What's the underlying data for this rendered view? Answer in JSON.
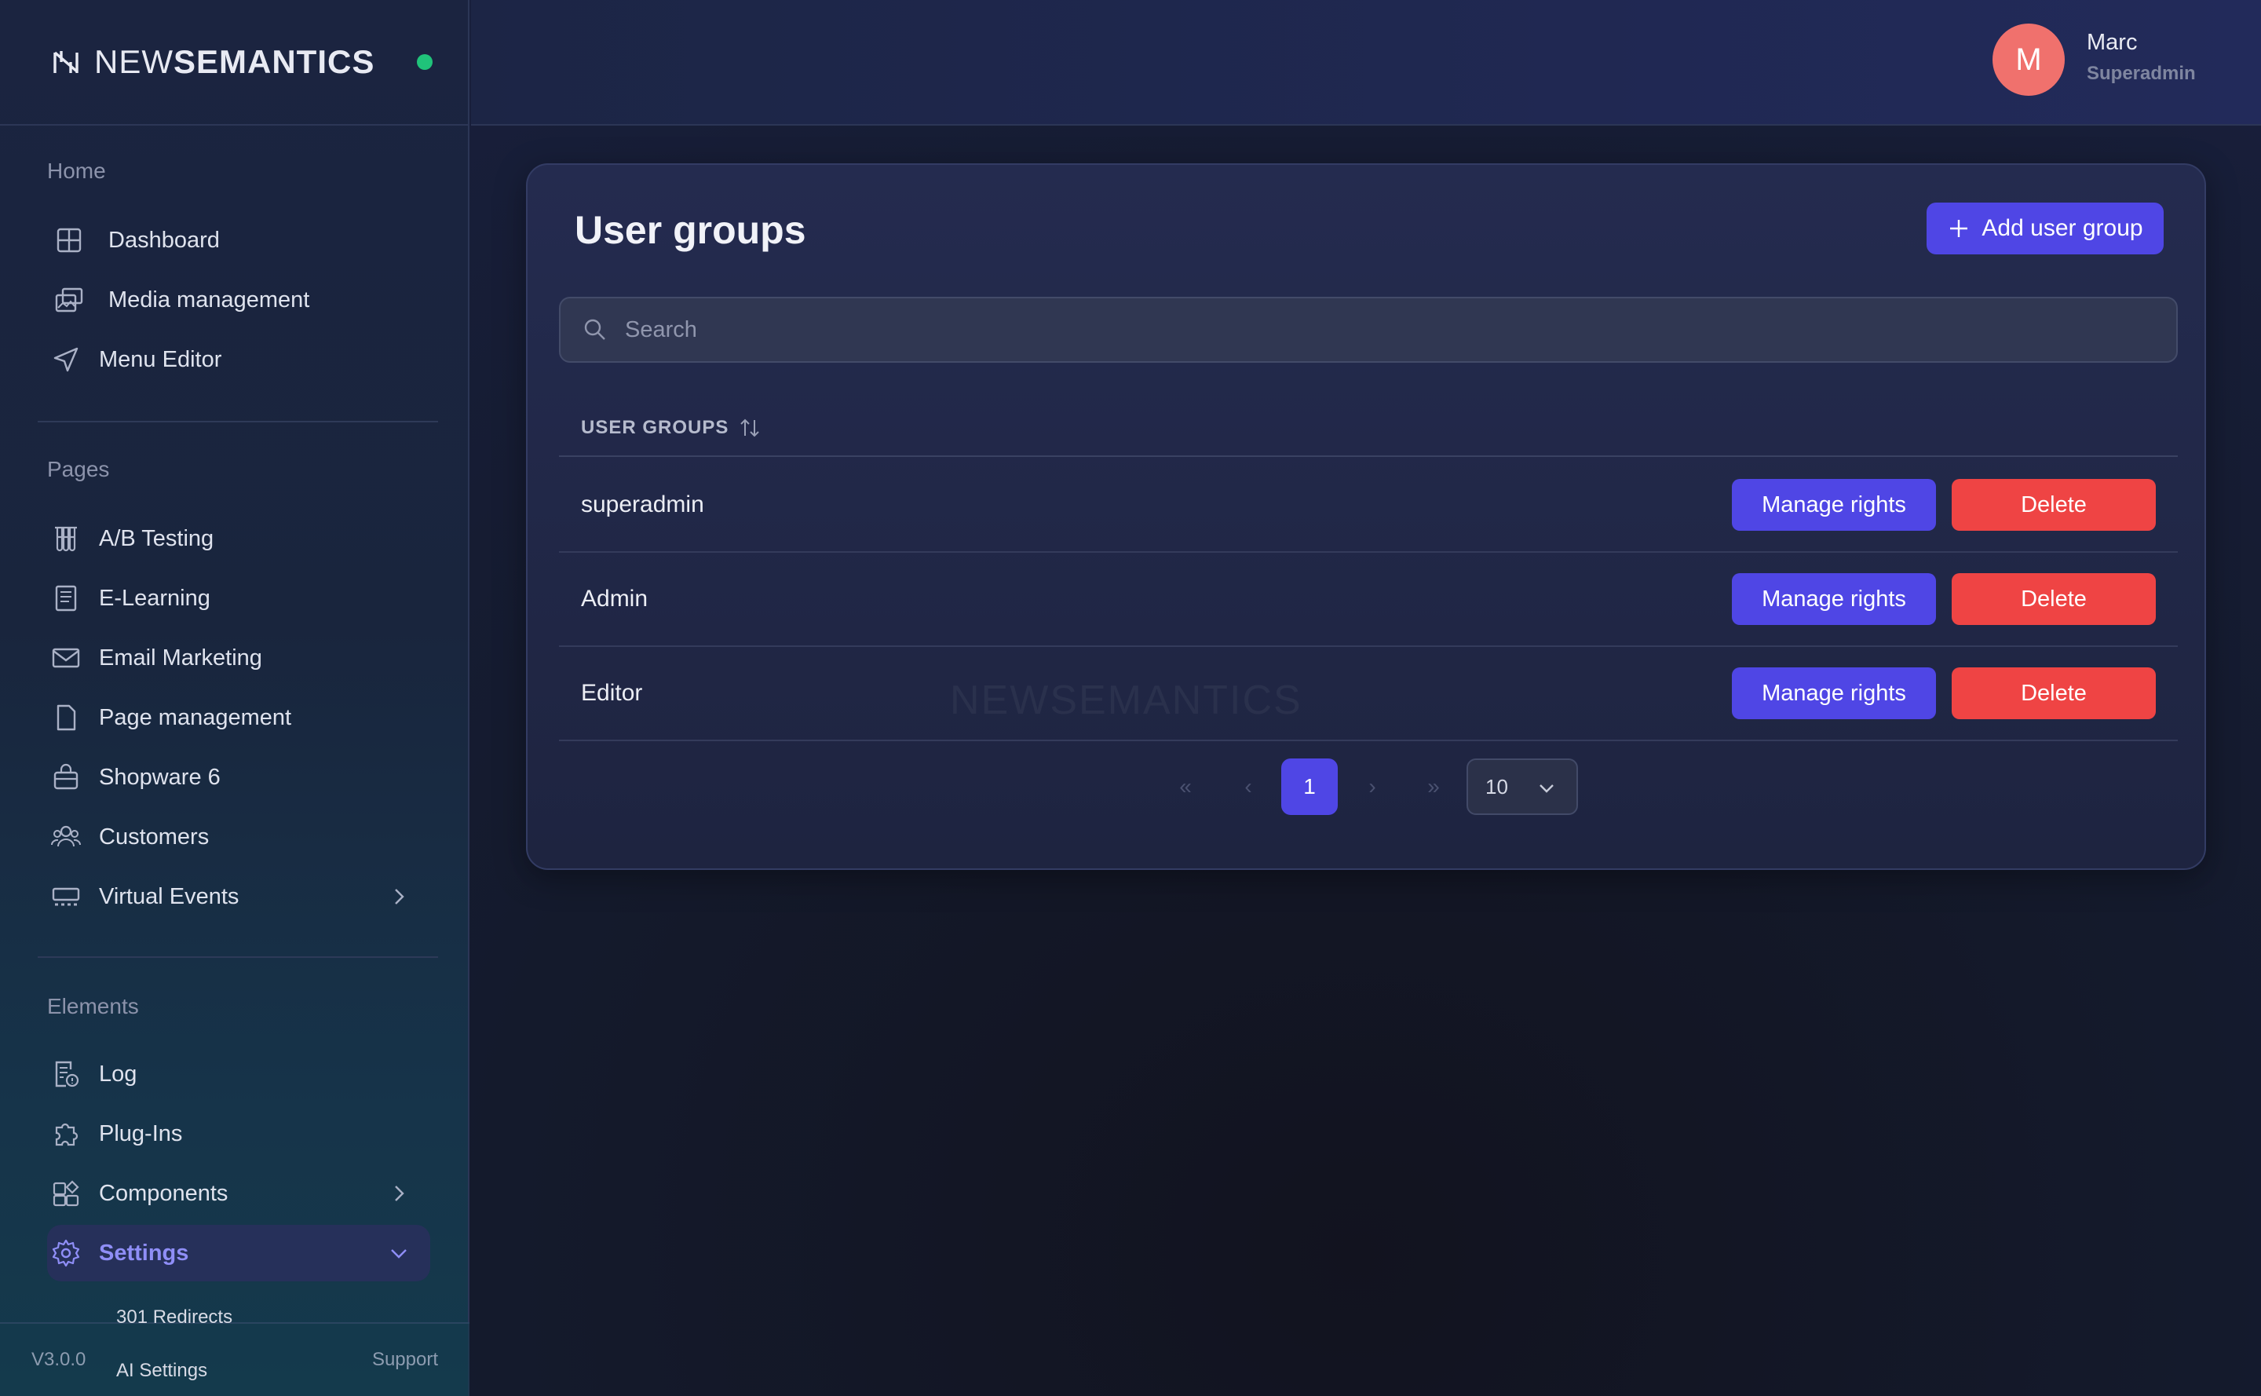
{
  "brand": {
    "name_light": "NEW",
    "name_bold": "SEMANTICS"
  },
  "user": {
    "initial": "M",
    "name": "Marc",
    "role": "Superadmin"
  },
  "sidebar": {
    "sections": [
      {
        "title": "Home",
        "items": [
          {
            "label": "Dashboard",
            "icon": "dashboard-icon"
          },
          {
            "label": "Media management",
            "icon": "media-icon"
          },
          {
            "label": "Menu Editor",
            "icon": "send-icon"
          }
        ]
      },
      {
        "title": "Pages",
        "items": [
          {
            "label": "A/B Testing",
            "icon": "test-tubes-icon"
          },
          {
            "label": "E-Learning",
            "icon": "book-icon"
          },
          {
            "label": "Email Marketing",
            "icon": "mail-icon"
          },
          {
            "label": "Page management",
            "icon": "file-icon"
          },
          {
            "label": "Shopware 6",
            "icon": "shopping-bag-icon"
          },
          {
            "label": "Customers",
            "icon": "users-icon"
          },
          {
            "label": "Virtual Events",
            "icon": "events-icon"
          }
        ]
      },
      {
        "title": "Elements",
        "items": [
          {
            "label": "Log",
            "icon": "log-icon"
          },
          {
            "label": "Plug-Ins",
            "icon": "puzzle-icon"
          },
          {
            "label": "Components",
            "icon": "components-icon"
          },
          {
            "label": "Settings",
            "icon": "gear-icon"
          }
        ]
      }
    ],
    "settings_sub": [
      "301 Redirects",
      "AI Settings"
    ],
    "version": "V3.0.0",
    "support": "Support"
  },
  "main": {
    "title": "User groups",
    "add_button": "Add user group",
    "search_placeholder": "Search",
    "column_header": "USER GROUPS",
    "rows": [
      {
        "name": "superadmin"
      },
      {
        "name": "Admin"
      },
      {
        "name": "Editor"
      }
    ],
    "manage_label": "Manage rights",
    "delete_label": "Delete",
    "pagination": {
      "first": "«",
      "prev": "‹",
      "current": "1",
      "next": "›",
      "last": "»",
      "page_size": "10"
    },
    "watermark": "NEWSEMANTICS"
  },
  "colors": {
    "accent": "#4f46e5",
    "danger": "#ef4444",
    "avatar": "#f0716d",
    "online": "#20c37a"
  }
}
